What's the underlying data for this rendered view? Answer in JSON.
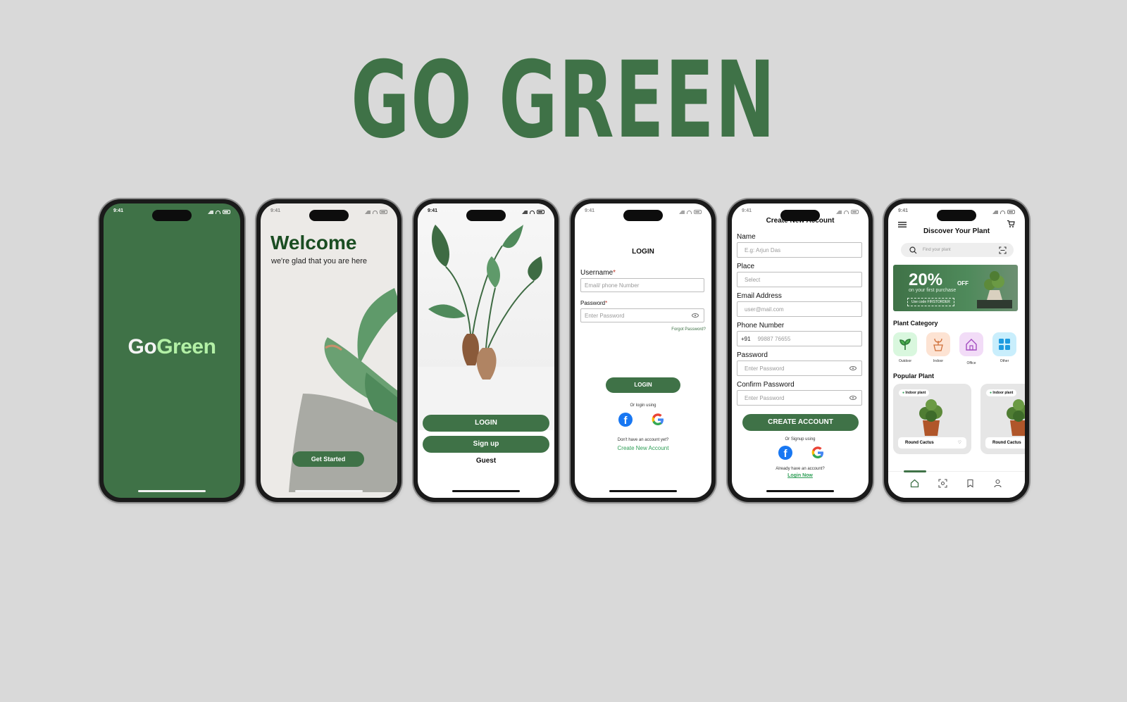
{
  "headline": "GO GREEN",
  "colors": {
    "background": "#d9d9d9",
    "brand_green": "#3f7247",
    "accent_light_green": "#b3f0a6",
    "link_green": "#2e9e56"
  },
  "time": "9:41",
  "splash": {
    "logo_go": "Go",
    "logo_green": "Green"
  },
  "welcome": {
    "title": "Welcome",
    "subtitle": "we're glad that  you are here",
    "button": "Get Started"
  },
  "entry": {
    "login": "LOGIN",
    "signup": "Sign up",
    "guest": "Guest"
  },
  "login": {
    "title": "LOGIN",
    "username_label": "Username",
    "username_placeholder": "Email/ phone Number",
    "password_label": "Password",
    "password_placeholder": "Enter Password",
    "required_mark": "*",
    "forgot": "Forgot Password?",
    "button": "LOGIN",
    "or_text": "Or login using",
    "no_account": "Don't have an account yet?",
    "create_link": "Create New Account"
  },
  "register": {
    "title": "Create New Account",
    "name_label": "Name",
    "name_placeholder": "E.g: Arjun Das",
    "place_label": "Place",
    "place_placeholder": "Select",
    "email_label": "Email Address",
    "email_placeholder": "user@mail.com",
    "phone_label": "Phone Number",
    "phone_code": "+91",
    "phone_placeholder": "99887 76655",
    "password_label": "Password",
    "password_placeholder": "Enter Password",
    "confirm_label": "Confirm Password",
    "confirm_placeholder": "Enter Password",
    "button": "CREATE ACCOUNT",
    "or_text": "Or Signup using",
    "have_account": "Already have an account?",
    "login_link": "Login Now"
  },
  "home": {
    "title": "Discover Your Plant",
    "search_placeholder": "Find your plant",
    "promo": {
      "percent": "20%",
      "off": "OFF",
      "sub": "on your first purchase",
      "code": "Use code FIRSTORDER"
    },
    "category_title": "Plant Category",
    "categories": [
      {
        "label": "Outdoor",
        "icon": "leaf-icon",
        "color": "#d9f7de"
      },
      {
        "label": "Indoor",
        "icon": "potted-plant-icon",
        "color": "#fde3d3"
      },
      {
        "label": "Office",
        "icon": "house-icon",
        "color": "#f2dcf7"
      },
      {
        "label": "Other",
        "icon": "grid-icon",
        "color": "#c9eefc"
      }
    ],
    "popular_title": "Popular Plant",
    "products": [
      {
        "tag": "Indoor plant",
        "name": "Round Cactus"
      },
      {
        "tag": "Indoor plant",
        "name": "Round Cactus"
      }
    ]
  }
}
